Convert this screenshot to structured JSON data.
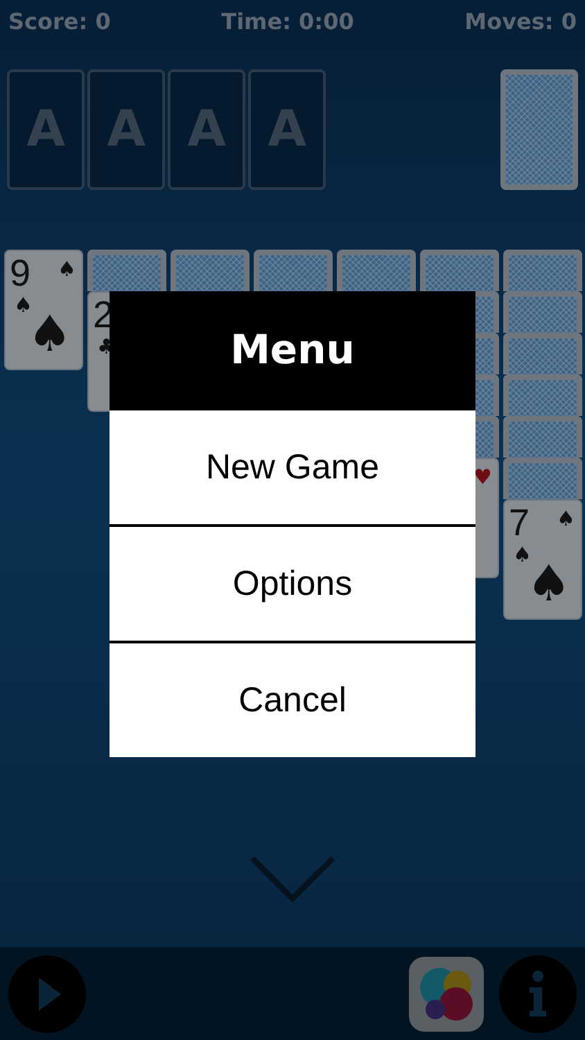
{
  "stats": [
    "Score: 0",
    "Time: 0:00",
    "Moves: 0"
  ],
  "foundations": [
    {
      "label": "A"
    },
    {
      "label": "A"
    },
    {
      "label": "A"
    },
    {
      "label": "A"
    }
  ],
  "tableau": [
    {
      "cards": [
        {
          "kind": "face",
          "rank": "9",
          "corner_suit": "♠",
          "side_suit": "♠",
          "center_suit": "♠",
          "red": false
        }
      ]
    },
    {
      "cards": [
        {
          "kind": "back"
        },
        {
          "kind": "face",
          "rank": "2",
          "side_suit": "♣",
          "red": false
        }
      ]
    },
    {
      "cards": [
        {
          "kind": "back"
        }
      ]
    },
    {
      "cards": [
        {
          "kind": "back"
        }
      ]
    },
    {
      "cards": [
        {
          "kind": "back"
        }
      ]
    },
    {
      "cards": [
        {
          "kind": "back"
        },
        {
          "kind": "back"
        },
        {
          "kind": "back"
        },
        {
          "kind": "back"
        },
        {
          "kind": "back"
        },
        {
          "kind": "face",
          "corner_suit": "♥",
          "red": true
        }
      ]
    },
    {
      "cards": [
        {
          "kind": "back"
        },
        {
          "kind": "back"
        },
        {
          "kind": "back"
        },
        {
          "kind": "back"
        },
        {
          "kind": "back"
        },
        {
          "kind": "back"
        },
        {
          "kind": "face",
          "rank": "7",
          "corner_suit": "♠",
          "side_suit": "♠",
          "center_suit": "♠",
          "red": false
        }
      ]
    }
  ],
  "menu": {
    "title": "Menu",
    "items": [
      "New Game",
      "Options",
      "Cancel"
    ]
  }
}
